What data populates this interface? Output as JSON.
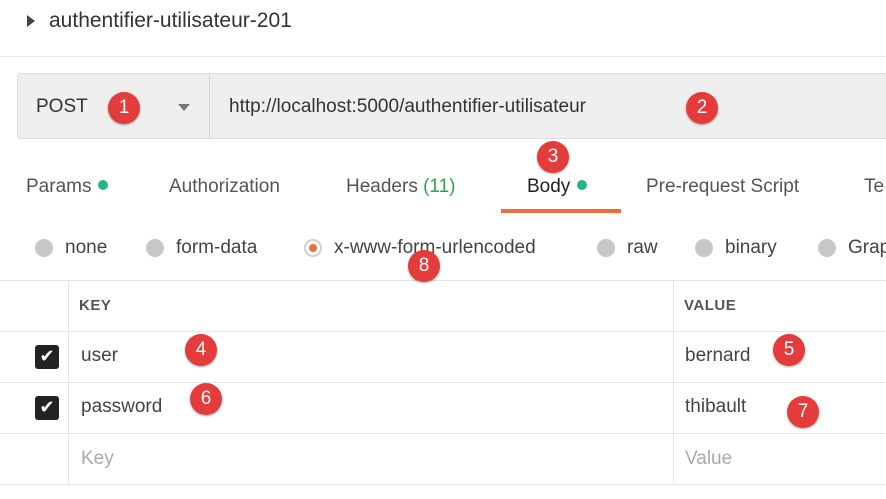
{
  "header": {
    "title": "authentifier-utilisateur-201"
  },
  "request": {
    "method": "POST",
    "url": "http://localhost:5000/authentifier-utilisateur"
  },
  "tabs": [
    {
      "label": "Params",
      "dot": true
    },
    {
      "label": "Authorization"
    },
    {
      "label": "Headers",
      "count": "(11)"
    },
    {
      "label": "Body",
      "dot": true,
      "active": true
    },
    {
      "label": "Pre-request Script"
    },
    {
      "label": "Te"
    }
  ],
  "body_modes": [
    {
      "label": "none",
      "selected": false
    },
    {
      "label": "form-data",
      "selected": false
    },
    {
      "label": "x-www-form-urlencoded",
      "selected": true
    },
    {
      "label": "raw",
      "selected": false
    },
    {
      "label": "binary",
      "selected": false
    },
    {
      "label": "Grap",
      "selected": false
    }
  ],
  "table": {
    "headers": {
      "key": "KEY",
      "value": "VALUE"
    },
    "rows": [
      {
        "checked": true,
        "key": "user",
        "value": "bernard"
      },
      {
        "checked": true,
        "key": "password",
        "value": "thibault"
      }
    ],
    "placeholder": {
      "key": "Key",
      "value": "Value"
    }
  },
  "annotations": [
    "1",
    "2",
    "3",
    "4",
    "5",
    "6",
    "7",
    "8"
  ],
  "colors": {
    "accent": "#f26b3a",
    "status_dot": "#26b47f",
    "header_count": "#2ea44f",
    "annotation_badge": "#e43b3b"
  },
  "icons": {
    "checkbox": "check-mark-icon",
    "expand": "caret-right-icon",
    "dropdown": "caret-down-icon"
  }
}
